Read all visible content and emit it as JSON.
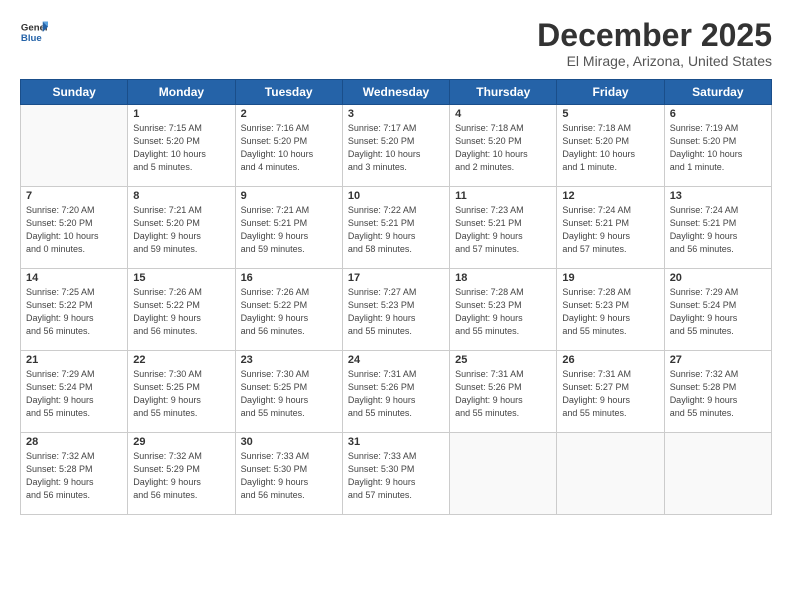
{
  "logo": {
    "line1": "General",
    "line2": "Blue"
  },
  "title": "December 2025",
  "location": "El Mirage, Arizona, United States",
  "weekdays": [
    "Sunday",
    "Monday",
    "Tuesday",
    "Wednesday",
    "Thursday",
    "Friday",
    "Saturday"
  ],
  "weeks": [
    [
      {
        "day": "",
        "info": ""
      },
      {
        "day": "1",
        "info": "Sunrise: 7:15 AM\nSunset: 5:20 PM\nDaylight: 10 hours\nand 5 minutes."
      },
      {
        "day": "2",
        "info": "Sunrise: 7:16 AM\nSunset: 5:20 PM\nDaylight: 10 hours\nand 4 minutes."
      },
      {
        "day": "3",
        "info": "Sunrise: 7:17 AM\nSunset: 5:20 PM\nDaylight: 10 hours\nand 3 minutes."
      },
      {
        "day": "4",
        "info": "Sunrise: 7:18 AM\nSunset: 5:20 PM\nDaylight: 10 hours\nand 2 minutes."
      },
      {
        "day": "5",
        "info": "Sunrise: 7:18 AM\nSunset: 5:20 PM\nDaylight: 10 hours\nand 1 minute."
      },
      {
        "day": "6",
        "info": "Sunrise: 7:19 AM\nSunset: 5:20 PM\nDaylight: 10 hours\nand 1 minute."
      }
    ],
    [
      {
        "day": "7",
        "info": "Sunrise: 7:20 AM\nSunset: 5:20 PM\nDaylight: 10 hours\nand 0 minutes."
      },
      {
        "day": "8",
        "info": "Sunrise: 7:21 AM\nSunset: 5:20 PM\nDaylight: 9 hours\nand 59 minutes."
      },
      {
        "day": "9",
        "info": "Sunrise: 7:21 AM\nSunset: 5:21 PM\nDaylight: 9 hours\nand 59 minutes."
      },
      {
        "day": "10",
        "info": "Sunrise: 7:22 AM\nSunset: 5:21 PM\nDaylight: 9 hours\nand 58 minutes."
      },
      {
        "day": "11",
        "info": "Sunrise: 7:23 AM\nSunset: 5:21 PM\nDaylight: 9 hours\nand 57 minutes."
      },
      {
        "day": "12",
        "info": "Sunrise: 7:24 AM\nSunset: 5:21 PM\nDaylight: 9 hours\nand 57 minutes."
      },
      {
        "day": "13",
        "info": "Sunrise: 7:24 AM\nSunset: 5:21 PM\nDaylight: 9 hours\nand 56 minutes."
      }
    ],
    [
      {
        "day": "14",
        "info": "Sunrise: 7:25 AM\nSunset: 5:22 PM\nDaylight: 9 hours\nand 56 minutes."
      },
      {
        "day": "15",
        "info": "Sunrise: 7:26 AM\nSunset: 5:22 PM\nDaylight: 9 hours\nand 56 minutes."
      },
      {
        "day": "16",
        "info": "Sunrise: 7:26 AM\nSunset: 5:22 PM\nDaylight: 9 hours\nand 56 minutes."
      },
      {
        "day": "17",
        "info": "Sunrise: 7:27 AM\nSunset: 5:23 PM\nDaylight: 9 hours\nand 55 minutes."
      },
      {
        "day": "18",
        "info": "Sunrise: 7:28 AM\nSunset: 5:23 PM\nDaylight: 9 hours\nand 55 minutes."
      },
      {
        "day": "19",
        "info": "Sunrise: 7:28 AM\nSunset: 5:23 PM\nDaylight: 9 hours\nand 55 minutes."
      },
      {
        "day": "20",
        "info": "Sunrise: 7:29 AM\nSunset: 5:24 PM\nDaylight: 9 hours\nand 55 minutes."
      }
    ],
    [
      {
        "day": "21",
        "info": "Sunrise: 7:29 AM\nSunset: 5:24 PM\nDaylight: 9 hours\nand 55 minutes."
      },
      {
        "day": "22",
        "info": "Sunrise: 7:30 AM\nSunset: 5:25 PM\nDaylight: 9 hours\nand 55 minutes."
      },
      {
        "day": "23",
        "info": "Sunrise: 7:30 AM\nSunset: 5:25 PM\nDaylight: 9 hours\nand 55 minutes."
      },
      {
        "day": "24",
        "info": "Sunrise: 7:31 AM\nSunset: 5:26 PM\nDaylight: 9 hours\nand 55 minutes."
      },
      {
        "day": "25",
        "info": "Sunrise: 7:31 AM\nSunset: 5:26 PM\nDaylight: 9 hours\nand 55 minutes."
      },
      {
        "day": "26",
        "info": "Sunrise: 7:31 AM\nSunset: 5:27 PM\nDaylight: 9 hours\nand 55 minutes."
      },
      {
        "day": "27",
        "info": "Sunrise: 7:32 AM\nSunset: 5:28 PM\nDaylight: 9 hours\nand 55 minutes."
      }
    ],
    [
      {
        "day": "28",
        "info": "Sunrise: 7:32 AM\nSunset: 5:28 PM\nDaylight: 9 hours\nand 56 minutes."
      },
      {
        "day": "29",
        "info": "Sunrise: 7:32 AM\nSunset: 5:29 PM\nDaylight: 9 hours\nand 56 minutes."
      },
      {
        "day": "30",
        "info": "Sunrise: 7:33 AM\nSunset: 5:30 PM\nDaylight: 9 hours\nand 56 minutes."
      },
      {
        "day": "31",
        "info": "Sunrise: 7:33 AM\nSunset: 5:30 PM\nDaylight: 9 hours\nand 57 minutes."
      },
      {
        "day": "",
        "info": ""
      },
      {
        "day": "",
        "info": ""
      },
      {
        "day": "",
        "info": ""
      }
    ]
  ]
}
